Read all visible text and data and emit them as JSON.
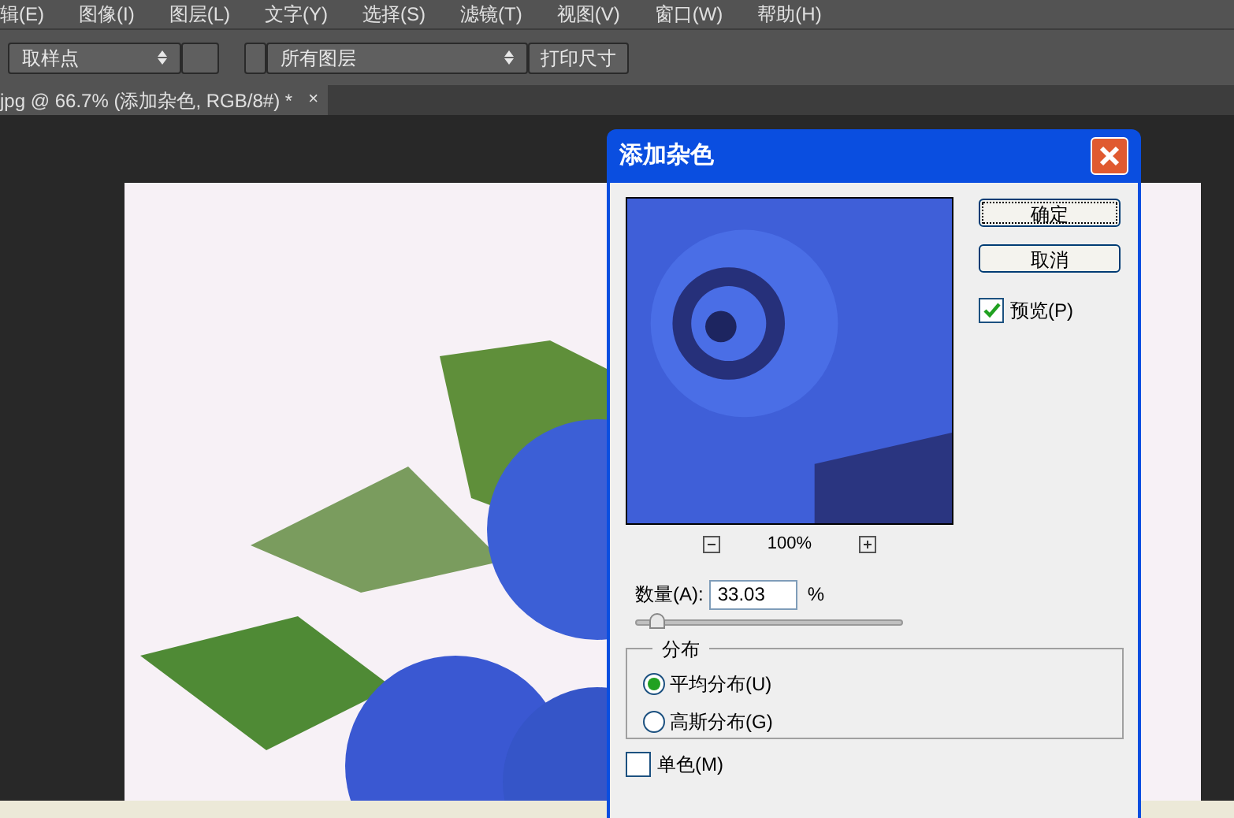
{
  "menu_bar": {
    "items": [
      "辑(E)",
      "图像(I)",
      "图层(L)",
      "文字(Y)",
      "选择(S)",
      "滤镜(T)",
      "视图(V)",
      "窗口(W)",
      "帮助(H)"
    ]
  },
  "options_bar": {
    "sample_dropdown": "取样点",
    "layers_dropdown": "所有图层",
    "print_size_button": "打印尺寸"
  },
  "document_tab": {
    "title": "jpg @ 66.7% (添加杂色, RGB/8#) *",
    "close": "×"
  },
  "dialog": {
    "title": "添加杂色",
    "ok_button": "确定",
    "cancel_button": "取消",
    "preview": {
      "label": "预览(P)",
      "checked": true
    },
    "zoom": {
      "value": "100%"
    },
    "amount": {
      "label": "数量(A):",
      "value": "33.03",
      "unit": "%",
      "level": 0.08
    },
    "distribution": {
      "title": "分布",
      "options": [
        {
          "label": "平均分布(U)",
          "selected": true
        },
        {
          "label": "高斯分布(G)",
          "selected": false
        }
      ]
    },
    "monochrome": {
      "label": "单色(M)",
      "checked": false
    }
  }
}
